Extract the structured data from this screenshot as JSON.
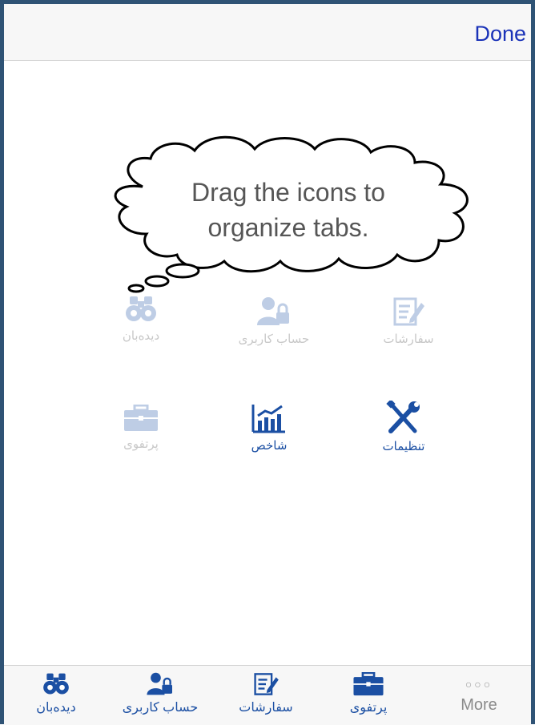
{
  "navbar": {
    "done_label": "Done"
  },
  "hint": {
    "line1": "Drag the icons to",
    "line2": "organize tabs."
  },
  "grid": {
    "row1": [
      {
        "label": "دیده‌بان",
        "icon": "binoculars-icon",
        "state": "faded"
      },
      {
        "label": "حساب کاربری",
        "icon": "user-lock-icon",
        "state": "faded"
      },
      {
        "label": "سفارشات",
        "icon": "orders-edit-icon",
        "state": "faded"
      }
    ],
    "row2": [
      {
        "label": "پرتفوی",
        "icon": "briefcase-icon",
        "state": "faded"
      },
      {
        "label": "شاخص",
        "icon": "index-chart-icon",
        "state": "active"
      },
      {
        "label": "تنظیمات",
        "icon": "settings-tools-icon",
        "state": "active"
      }
    ]
  },
  "tabbar": {
    "tabs": [
      {
        "label": "دیده‌بان",
        "icon": "binoculars-icon"
      },
      {
        "label": "حساب کاربری",
        "icon": "user-lock-icon"
      },
      {
        "label": "سفارشات",
        "icon": "orders-edit-icon"
      },
      {
        "label": "پرتفوی",
        "icon": "briefcase-icon"
      },
      {
        "label": "More",
        "icon": "more-dots-icon"
      }
    ],
    "more_dots": "○○○"
  },
  "colors": {
    "accent": "#1b4fa3",
    "done": "#1a32b8",
    "frame": "#2f5375"
  }
}
